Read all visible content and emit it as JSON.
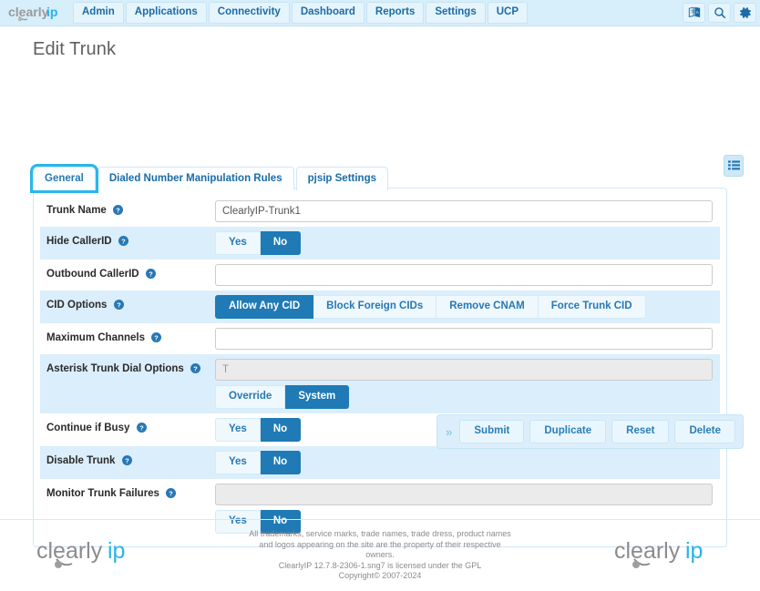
{
  "navbar": {
    "brand": "clearlyip",
    "items": [
      {
        "label": "Admin",
        "name": "nav-admin"
      },
      {
        "label": "Applications",
        "name": "nav-applications"
      },
      {
        "label": "Connectivity",
        "name": "nav-connectivity"
      },
      {
        "label": "Dashboard",
        "name": "nav-dashboard"
      },
      {
        "label": "Reports",
        "name": "nav-reports"
      },
      {
        "label": "Settings",
        "name": "nav-settings"
      },
      {
        "label": "UCP",
        "name": "nav-ucp"
      }
    ],
    "icons": [
      {
        "name": "translate-icon"
      },
      {
        "name": "search-icon"
      },
      {
        "name": "gear-icon"
      }
    ],
    "background": "#d7eefb",
    "link_color": "#1b6ca8"
  },
  "page": {
    "title": "Edit Trunk"
  },
  "panel_toolbar": {
    "list_button": "list-icon"
  },
  "tabs": [
    {
      "label": "General",
      "active": true
    },
    {
      "label": "Dialed Number Manipulation Rules",
      "active": false
    },
    {
      "label": "pjsip Settings",
      "active": false
    }
  ],
  "form": {
    "rows": [
      {
        "label": "Trunk Name",
        "help": "?",
        "type": "text",
        "value": "ClearlyIP-Trunk1",
        "placeholder": "",
        "disabled": false,
        "shaded": false
      },
      {
        "label": "Hide CallerID",
        "help": "?",
        "type": "toggle",
        "options": [
          "Yes",
          "No"
        ],
        "selected": "No",
        "shaded": true
      },
      {
        "label": "Outbound CallerID",
        "help": "?",
        "type": "text",
        "value": "",
        "placeholder": "",
        "disabled": false,
        "shaded": false
      },
      {
        "label": "CID Options",
        "help": "?",
        "type": "toggle",
        "options": [
          "Allow Any CID",
          "Block Foreign CIDs",
          "Remove CNAM",
          "Force Trunk CID"
        ],
        "selected": "Allow Any CID",
        "shaded": true
      },
      {
        "label": "Maximum Channels",
        "help": "?",
        "type": "text",
        "value": "",
        "placeholder": "",
        "disabled": false,
        "shaded": false
      },
      {
        "label": "Asterisk Trunk Dial Options",
        "help": "?",
        "type": "text-toggle",
        "value": "T",
        "disabled": true,
        "options": [
          "Override",
          "System"
        ],
        "selected": "System",
        "shaded": true
      },
      {
        "label": "Continue if Busy",
        "help": "?",
        "type": "toggle",
        "options": [
          "Yes",
          "No"
        ],
        "selected": "No",
        "shaded": false
      },
      {
        "label": "Disable Trunk",
        "help": "?",
        "type": "toggle",
        "options": [
          "Yes",
          "No"
        ],
        "selected": "No",
        "shaded": true
      },
      {
        "label": "Monitor Trunk Failures",
        "help": "?",
        "type": "text-toggle",
        "value": "",
        "disabled": true,
        "options": [
          "Yes",
          "No"
        ],
        "selected": "No",
        "shaded": false
      }
    ]
  },
  "actions": {
    "expander": "»",
    "buttons": [
      "Submit",
      "Duplicate",
      "Reset",
      "Delete"
    ]
  },
  "footer": {
    "logo": "clearlyip",
    "line1": "All trademarks, service marks, trade names, trade dress, product names and logos appearing on the site are the property of their respective owners.",
    "line2": "ClearlyIP 12.7.8-2306-1.sng7 is licensed under the GPL",
    "line3": "Copyright© 2007-2024"
  }
}
